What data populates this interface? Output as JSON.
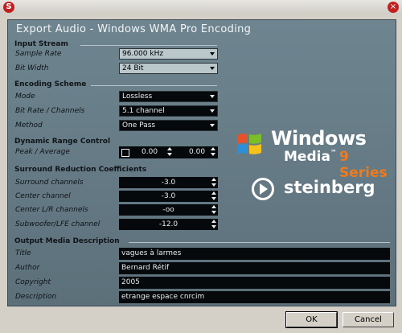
{
  "window": {
    "logo_glyph": "S",
    "close_glyph": "×"
  },
  "dialog": {
    "title": "Export Audio - Windows WMA Pro Encoding"
  },
  "input_stream": {
    "title": "Input Stream",
    "sample_rate_label": "Sample Rate",
    "sample_rate_value": "96.000 kHz",
    "bit_width_label": "Bit Width",
    "bit_width_value": "24 Bit"
  },
  "encoding_scheme": {
    "title": "Encoding Scheme",
    "mode_label": "Mode",
    "mode_value": "Lossless",
    "bitrate_label": "Bit Rate / Channels",
    "bitrate_value": "5.1 channel",
    "method_label": "Method",
    "method_value": "One Pass"
  },
  "dynamic_range": {
    "title": "Dynamic Range Control",
    "label": "Peak  /  Average",
    "peak_value": "0.00",
    "average_value": "0.00"
  },
  "surround": {
    "title": "Surround Reduction Coefficients",
    "rows": [
      {
        "label": "Surround channels",
        "value": "-3.0"
      },
      {
        "label": "Center channel",
        "value": "-3.0"
      },
      {
        "label": "Center L/R channels",
        "value": "-oo"
      },
      {
        "label": "Subwoofer/LFE channel",
        "value": "-12.0"
      }
    ]
  },
  "output_media": {
    "title": "Output Media Description",
    "fields": [
      {
        "label": "Title",
        "value": "vagues à larmes"
      },
      {
        "label": "Author",
        "value": "Bernard Rétif"
      },
      {
        "label": "Copyright",
        "value": "2005"
      },
      {
        "label": "Description",
        "value": "etrange espace cnrcim"
      }
    ]
  },
  "branding": {
    "wm_line1": "Windows",
    "wm_line2": "Media",
    "wm_tm": "™",
    "wm_line3": "9 Series",
    "steinberg": "steinberg"
  },
  "buttons": {
    "ok": "OK",
    "cancel": "Cancel"
  },
  "colors": {
    "panel": "#667c86",
    "accent_orange": "#f07a1c",
    "field_dark": "#06090b"
  }
}
